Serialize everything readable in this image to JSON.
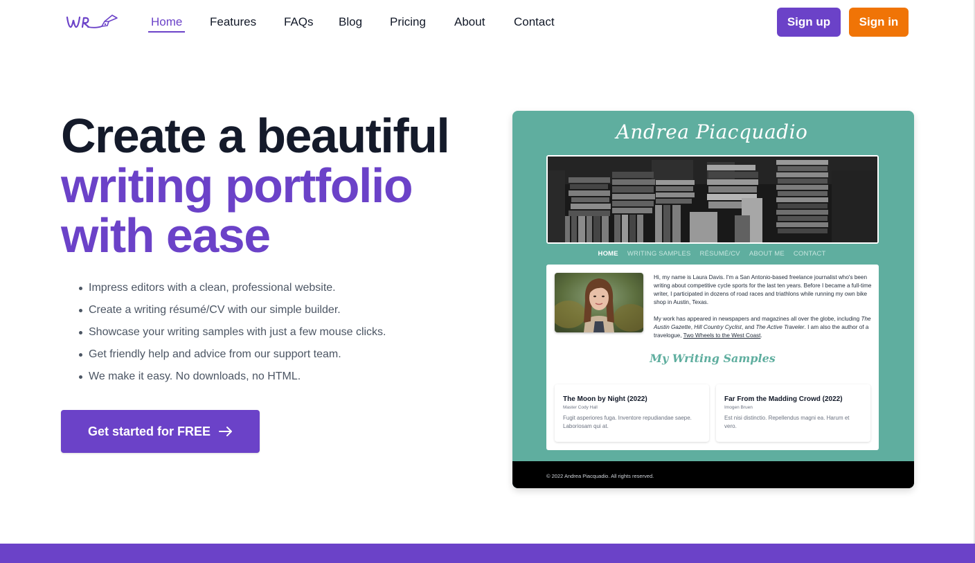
{
  "brand": {
    "logo_text": "WR",
    "accent_color": "#6b42c8",
    "secondary_color": "#f07406"
  },
  "nav": {
    "items": [
      {
        "label": "Home",
        "active": true
      },
      {
        "label": "Features",
        "active": false
      },
      {
        "label": "FAQs",
        "active": false
      },
      {
        "label": "Blog",
        "active": false
      },
      {
        "label": "Pricing",
        "active": false
      },
      {
        "label": "About",
        "active": false
      },
      {
        "label": "Contact",
        "active": false
      }
    ],
    "signup_label": "Sign up",
    "signin_label": "Sign in"
  },
  "hero": {
    "title_line1": "Create a beautiful",
    "title_line2": "writing portfolio",
    "title_line3": "with ease",
    "features": [
      "Impress editors with a clean, professional website.",
      "Create a writing résumé/CV with our simple builder.",
      "Showcase your writing samples with just a few mouse clicks.",
      "Get friendly help and advice from our support team.",
      "We make it easy. No downloads, no HTML."
    ],
    "cta_label": "Get started for FREE",
    "cta_icon": "arrow-right-icon"
  },
  "preview": {
    "bg_color": "#5fae9f",
    "site_name": "Andrea Piacquadio",
    "nav": [
      "HOME",
      "WRITING SAMPLES",
      "RÉSUMÉ/CV",
      "ABOUT ME",
      "CONTACT"
    ],
    "bio": {
      "p1": "Hi, my name is Laura Davis. I'm a San Antonio-based freelance journalist who's been writing about competitive cycle sports for the last ten years. Before I became a full-time writer, I participated in dozens of road races and triathlons while running my own bike shop in Austin, Texas.",
      "p2_before": "My work has appeared in newspapers and magazines all over the globe, including ",
      "pub1": "The Austin Gazette",
      "sep1": ", ",
      "pub2": "Hill Country Cyclist",
      "sep2": ", and ",
      "pub3": "The Active Traveler",
      "p2_mid": ". I am also the author of a travelogue, ",
      "book_link": "Two Wheels to the West Coast",
      "p2_end": "."
    },
    "samples_title": "My Writing Samples",
    "samples": [
      {
        "title": "The Moon by Night (2022)",
        "author": "Master Cody Hall",
        "description": "Fugit asperiores fuga. Inventore repudiandae saepe. Laboriosam qui at."
      },
      {
        "title": "Far From the Madding Crowd (2022)",
        "author": "Imogen Bruen",
        "description": "Est nisi distinctio. Repellendus magni ea. Harum et vero."
      }
    ],
    "footer": "© 2022 Andrea Piacquadio. All rights reserved."
  }
}
